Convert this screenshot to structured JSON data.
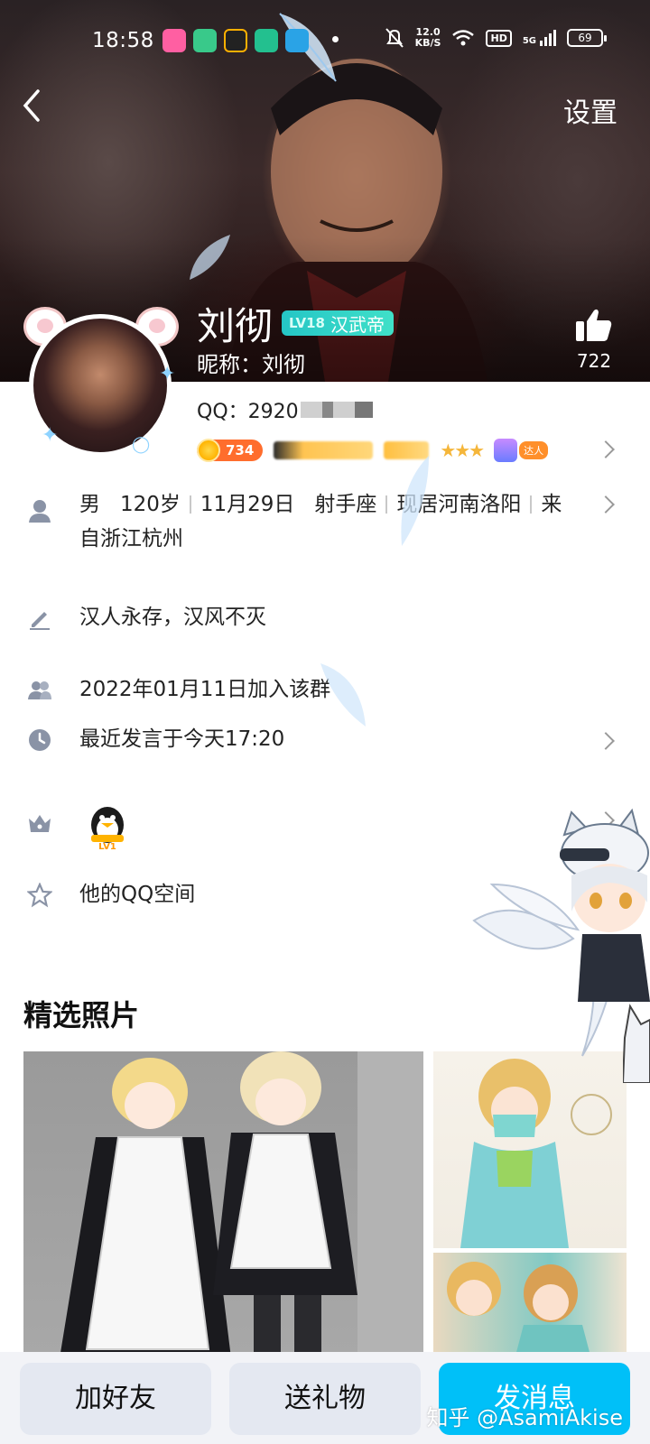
{
  "status_bar": {
    "time": "18:58",
    "net_speed_value": "12.0",
    "net_speed_unit": "KB/S",
    "hd_label": "HD",
    "signal_label": "5G",
    "battery": "69"
  },
  "header": {
    "settings_label": "设置"
  },
  "profile": {
    "name": "刘彻",
    "level_tag": "LV18",
    "title_tag": "汉武帝",
    "nickname_label": "昵称：刘彻",
    "qq_label": "QQ：2920",
    "likes": "722",
    "coin_count": "734",
    "expert_label": "达人"
  },
  "info_rows": {
    "basic": {
      "gender": "男",
      "age": "120岁",
      "birthday": "11月29日",
      "zodiac": "射手座",
      "location": "现居河南洛阳",
      "hometown_line1": "来",
      "hometown_line2": "自浙江杭州"
    },
    "signature": "汉人永存，汉风不灭",
    "join_date": "2022年01月11日加入该群",
    "last_active": "最近发言于今天17:20",
    "qzone": "他的QQ空间"
  },
  "photos": {
    "title": "精选照片"
  },
  "actions": {
    "add_friend": "加好友",
    "send_gift": "送礼物",
    "send_message": "发消息"
  },
  "watermark": "知乎 @AsamiAkise",
  "colors": {
    "accent": "#00c0f8",
    "coin": "#ff6d2d",
    "level_badge": "#25c6c6",
    "button_bg": "#e4e8f1"
  }
}
